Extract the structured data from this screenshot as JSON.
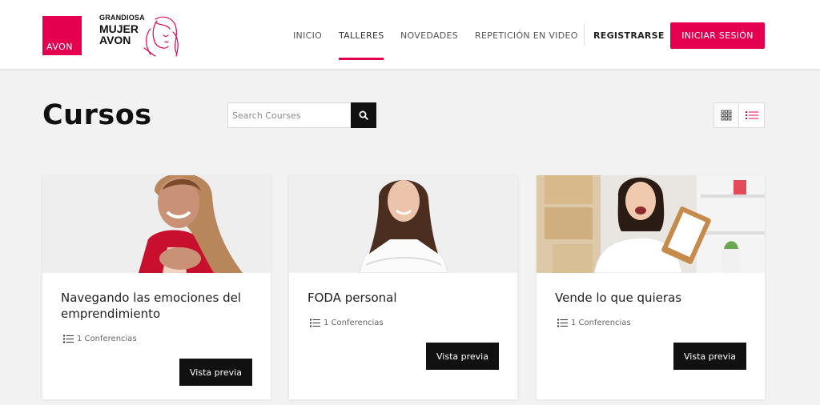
{
  "brand": {
    "avon_logo_text": "AVON",
    "campaign_line1": "GRANDIOSA",
    "campaign_line2": "MUJER",
    "campaign_line3": "AVON",
    "accent_color": "#e4004f"
  },
  "nav": {
    "items": [
      {
        "label": "INICIO"
      },
      {
        "label": "TALLERES",
        "active": true
      },
      {
        "label": "NOVEDADES"
      },
      {
        "label": "REPETICIÓN EN VIDEO"
      }
    ],
    "register_label": "REGISTRARSE",
    "login_label": "INICIAR SESIÓN"
  },
  "page": {
    "title": "Cursos",
    "search": {
      "placeholder": "Search Courses",
      "value": "",
      "icon": "search-icon"
    },
    "view_toggle": [
      {
        "icon": "grid-icon"
      },
      {
        "icon": "list-icon",
        "active": true
      }
    ]
  },
  "courses": [
    {
      "title": "Navegando las emociones del emprendimiento",
      "lectures": "1 Conferencias",
      "button": "Vista previa",
      "image": "woman-red-jacket-photo"
    },
    {
      "title": "FODA personal",
      "lectures": "1 Conferencias",
      "button": "Vista previa",
      "image": "woman-white-shirt-photo"
    },
    {
      "title": "Vende lo que quieras",
      "lectures": "1 Conferencias",
      "button": "Vista previa",
      "image": "woman-clipboard-boxes-photo"
    }
  ]
}
